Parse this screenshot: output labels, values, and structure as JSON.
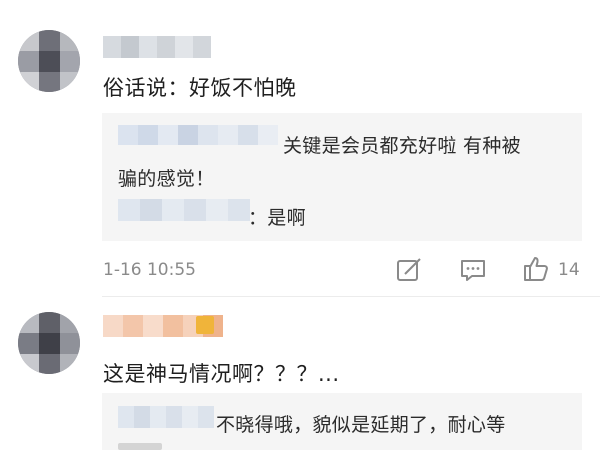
{
  "comments": [
    {
      "text": "俗话说：好饭不怕晚",
      "replies": [
        {
          "line1": "关键是会员都充好啦  有种被",
          "line2": "骗的感觉！"
        },
        {
          "line1": "：是啊"
        }
      ],
      "time": "1-16 10:55",
      "likes": "14"
    },
    {
      "text": "这是神马情况啊？？？...",
      "replies": [
        {
          "line1": "不晓得哦，貌似是延期了，耐心等"
        }
      ]
    }
  ],
  "icons": {
    "repost": "edit-square-icon",
    "comment": "comment-icon",
    "like": "thumbs-up-icon"
  },
  "colors": {
    "reply_bg": "#f5f5f5",
    "meta_gray": "#8a8a8a",
    "text": "#1f1f1f"
  }
}
